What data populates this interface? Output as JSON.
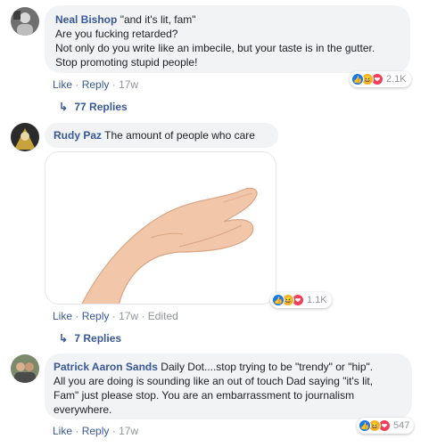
{
  "comments": [
    {
      "author": "Neal Bishop",
      "text_lines": [
        "\"and it's lit, fam\"",
        "Are you fucking retarded?",
        "Not only do you write like an imbecile, but your taste is in the gutter.",
        "Stop promoting stupid people!"
      ],
      "actions": {
        "like": "Like",
        "reply": "Reply",
        "time": "17w"
      },
      "reactions": {
        "count": "2.1K"
      },
      "replies": {
        "label": "77 Replies"
      }
    },
    {
      "author": "Rudy Paz",
      "text": "The amount of people who care",
      "actions": {
        "like": "Like",
        "reply": "Reply",
        "time": "17w",
        "edited": "Edited"
      },
      "reactions": {
        "count": "1.1K"
      },
      "replies": {
        "label": "7 Replies"
      }
    },
    {
      "author": "Patrick Aaron Sands",
      "text_lines": [
        "Daily Dot....stop trying to be \"trendy\" or \"hip\".",
        "All you are doing is sounding like an out of touch Dad saying \"it's lit,",
        "Fam\" just please stop. You are an embarrassment to journalism",
        "everywhere."
      ],
      "actions": {
        "like": "Like",
        "reply": "Reply",
        "time": "17w"
      },
      "reactions": {
        "count": "547"
      }
    }
  ],
  "separator": "·",
  "reaction_icons": [
    "like-icon",
    "haha-icon",
    "love-icon"
  ],
  "colors": {
    "link": "#385898",
    "bubble": "#f2f3f5",
    "meta": "#90949c"
  }
}
